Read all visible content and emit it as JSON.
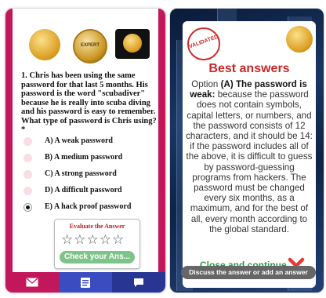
{
  "left_screen": {
    "badge_label": "EXPERT",
    "question": "1. Chris has been using the same password for that last 5 months. His password is the word \"scubadiver\" because he is really into scuba diving and his password is easy to remember. What type of password is Chris using? *",
    "options": [
      {
        "label": "A) A weak password",
        "selected": false
      },
      {
        "label": "B) A medium password",
        "selected": false
      },
      {
        "label": "C) A strong password",
        "selected": false
      },
      {
        "label": "D) A difficult password",
        "selected": false
      },
      {
        "label": "E) A hack proof password",
        "selected": true
      }
    ],
    "evaluate_title": "Evaluate the Answer",
    "rating_stars": "☆☆☆☆☆",
    "rating_value": 0,
    "check_button": "Check your Ans...",
    "nav_icons": [
      "mail-icon",
      "list-icon",
      "chat-icon"
    ]
  },
  "right_screen": {
    "stamp_text": "VALIDATED",
    "title": "Best answers",
    "answer_prefix": "Option ",
    "answer_option": "(A)",
    "answer_headline": "The password is weak:",
    "answer_body": "because the password does not contain symbols, capital letters, or numbers, and the password consists of 12 characters, and it should be 14: if the password includes all of the above, it is difficult to guess by password-guessing programs from hackers. The password must be changed every six months, as a maximum, and for the best of all, every month according to the global standard.",
    "close_label": "Close and continue",
    "discuss_label": "Discuss the answer or add an answer"
  },
  "colors": {
    "accent_magenta": "#c2185b",
    "nav_blue": "#3a4cc0",
    "title_red": "#c62828",
    "close_green": "#2e9b45",
    "x_red": "#e53935"
  }
}
